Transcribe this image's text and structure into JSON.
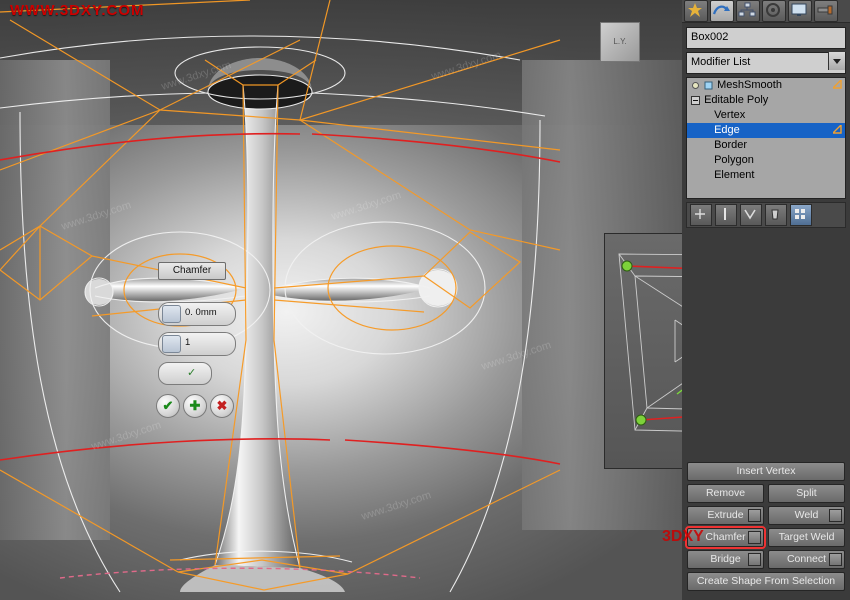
{
  "app": {
    "watermark_top": "WWW.3DXY.COM",
    "watermark_bottom": "3DXY",
    "faint_watermark": "www.3dxy.com"
  },
  "viewport": {
    "name": "perspective-viewport",
    "object_label": "L.Y.",
    "inset_name": "wireframe-inset-viewport"
  },
  "caddy": {
    "title": "Chamfer",
    "amount_value": "0. 0mm",
    "segments_value": "1",
    "open_smooth_checked": true,
    "ok_label": "✔",
    "apply_label": "✚",
    "cancel_label": "✖"
  },
  "panel": {
    "tabs": [
      {
        "name": "create-tab",
        "icon": "star-icon"
      },
      {
        "name": "modify-tab",
        "icon": "bent-arrow-icon"
      },
      {
        "name": "hierarchy-tab",
        "icon": "hierarchy-icon"
      },
      {
        "name": "motion-tab",
        "icon": "wheel-icon"
      },
      {
        "name": "display-tab",
        "icon": "monitor-icon"
      },
      {
        "name": "utilities-tab",
        "icon": "hammer-icon"
      }
    ],
    "object_name": "Box002",
    "modifier_list_label": "Modifier List",
    "stack": [
      {
        "label": "MeshSmooth",
        "indent": 1,
        "selected": false,
        "has_light": true,
        "has_corner": true
      },
      {
        "label": "Editable Poly",
        "indent": 0,
        "selected": false,
        "has_box": true
      },
      {
        "label": "Vertex",
        "indent": 2,
        "selected": false
      },
      {
        "label": "Edge",
        "indent": 2,
        "selected": true,
        "has_corner": true
      },
      {
        "label": "Border",
        "indent": 2,
        "selected": false
      },
      {
        "label": "Polygon",
        "indent": 2,
        "selected": false
      },
      {
        "label": "Element",
        "indent": 2,
        "selected": false
      }
    ],
    "stack_tools": [
      {
        "name": "pin-stack-button",
        "icon": "pin-icon"
      },
      {
        "name": "show-end-result-button",
        "icon": "flask-icon"
      },
      {
        "name": "make-unique-button",
        "icon": "chevron-icon"
      },
      {
        "name": "remove-modifier-button",
        "icon": "trash-icon"
      },
      {
        "name": "configure-modifier-sets-button",
        "icon": "grid-icon"
      }
    ],
    "edit_edges": {
      "insert_vertex": "Insert Vertex",
      "remove": "Remove",
      "split": "Split",
      "extrude": "Extrude",
      "weld": "Weld",
      "chamfer": "Chamfer",
      "target_weld": "Target Weld",
      "bridge": "Bridge",
      "connect": "Connect",
      "create_shape": "Create Shape From Selection"
    },
    "highlight_color": "#e03030",
    "selection_color": "#1763c6"
  }
}
